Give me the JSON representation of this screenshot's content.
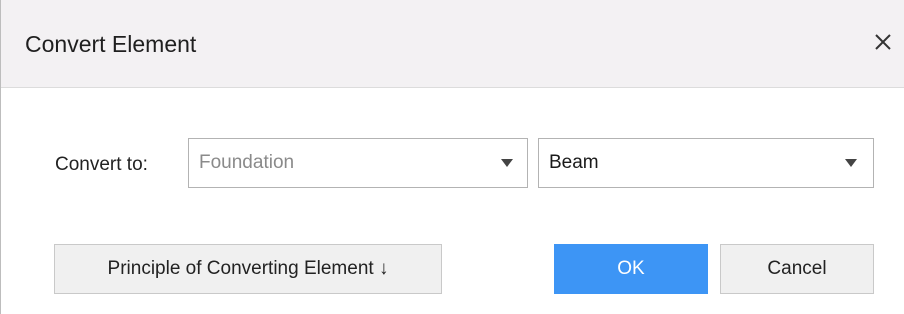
{
  "dialog": {
    "title": "Convert Element",
    "close_icon": "close-icon"
  },
  "form": {
    "label": "Convert to:",
    "source_select": {
      "value": "Foundation",
      "icon": "dropdown-arrow-icon"
    },
    "target_select": {
      "value": "Beam",
      "icon": "dropdown-arrow-icon"
    }
  },
  "buttons": {
    "principle": "Principle of Converting Element ↓",
    "ok": "OK",
    "cancel": "Cancel"
  },
  "colors": {
    "primary": "#3d95f5",
    "title_bar": "#f3f1f3"
  }
}
